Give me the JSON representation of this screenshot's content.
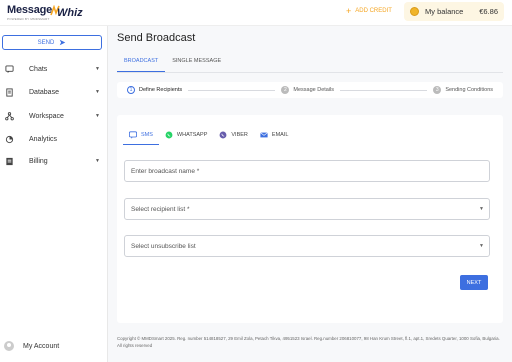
{
  "brand": {
    "word": "Message",
    "word2": "Whiz",
    "tagline": "POWERED BY MMDSMART"
  },
  "header": {
    "add_credit": "ADD CREDIT",
    "balance_label": "My balance",
    "balance_value": "€6.86"
  },
  "sidebar": {
    "send_label": "SEND",
    "items": [
      {
        "label": "Chats",
        "icon": "chat-icon",
        "has_chevron": true
      },
      {
        "label": "Database",
        "icon": "database-icon",
        "has_chevron": true
      },
      {
        "label": "Workspace",
        "icon": "workspace-icon",
        "has_chevron": true
      },
      {
        "label": "Analytics",
        "icon": "analytics-icon",
        "has_chevron": false
      },
      {
        "label": "Billing",
        "icon": "billing-icon",
        "has_chevron": true
      }
    ],
    "account_label": "My Account"
  },
  "main": {
    "title": "Send Broadcast",
    "tabs": [
      {
        "label": "BROADCAST",
        "active": true
      },
      {
        "label": "SINGLE MESSAGE",
        "active": false
      }
    ],
    "steps": [
      {
        "num": "1",
        "label": "Define Recipients",
        "active": true
      },
      {
        "num": "2",
        "label": "Message Details",
        "active": false
      },
      {
        "num": "3",
        "label": "Sending Conditions",
        "active": false
      }
    ],
    "channels": [
      {
        "label": "SMS",
        "icon": "sms-icon",
        "active": true
      },
      {
        "label": "WHATSAPP",
        "icon": "whatsapp-icon",
        "active": false
      },
      {
        "label": "VIBER",
        "icon": "viber-icon",
        "active": false
      },
      {
        "label": "EMAIL",
        "icon": "email-icon",
        "active": false
      }
    ],
    "fields": {
      "broadcast_name_placeholder": "Enter broadcast name *",
      "recipient_list_placeholder": "Select recipient list *",
      "unsubscribe_list_placeholder": "Select unsubscribe list"
    },
    "next_label": "NEXT"
  },
  "footer": {
    "text": "Copyright © MMDSmart 2025. Reg. number 514818527, 29 Emil Zola, Petach Tikva, 4951523 Israel. Reg.number 206810077, 98 Han Krum Street, fl.1, apt.1, Sredets Quarter, 1000 Sofia, Bulgaria. All rights reserved"
  },
  "colors": {
    "accent": "#3d6fe0",
    "credit": "#f5a623",
    "balance_bg": "#fdf6e3"
  }
}
